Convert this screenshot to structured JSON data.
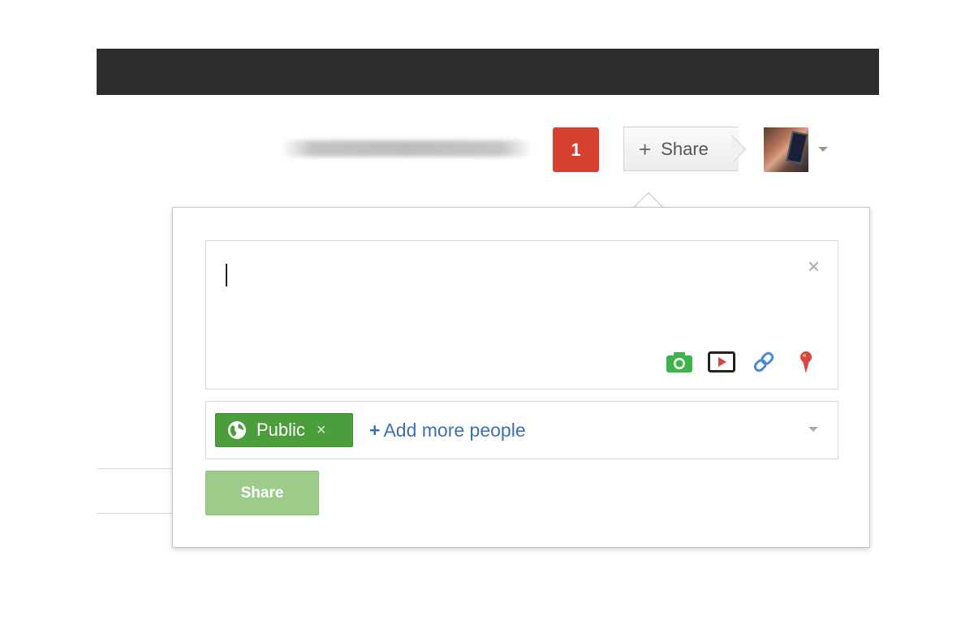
{
  "header": {
    "notification_count": "1",
    "share_label": "Share",
    "share_plus": "+"
  },
  "compose": {
    "close_glyph": "×",
    "icons": [
      "camera-icon",
      "video-icon",
      "link-icon",
      "location-pin-icon"
    ]
  },
  "audience": {
    "chip_label": "Public",
    "chip_remove_glyph": "×",
    "add_plus": "+",
    "add_people_label": "Add more people"
  },
  "share_button": {
    "label": "Share"
  },
  "colors": {
    "notification_red": "#d73f2f",
    "chip_green": "#4a9e3c",
    "share_button_green": "#9dcb8a",
    "link_blue": "#3f6fb3",
    "camera_green": "#3cb44b",
    "pin_red": "#d9453b"
  }
}
